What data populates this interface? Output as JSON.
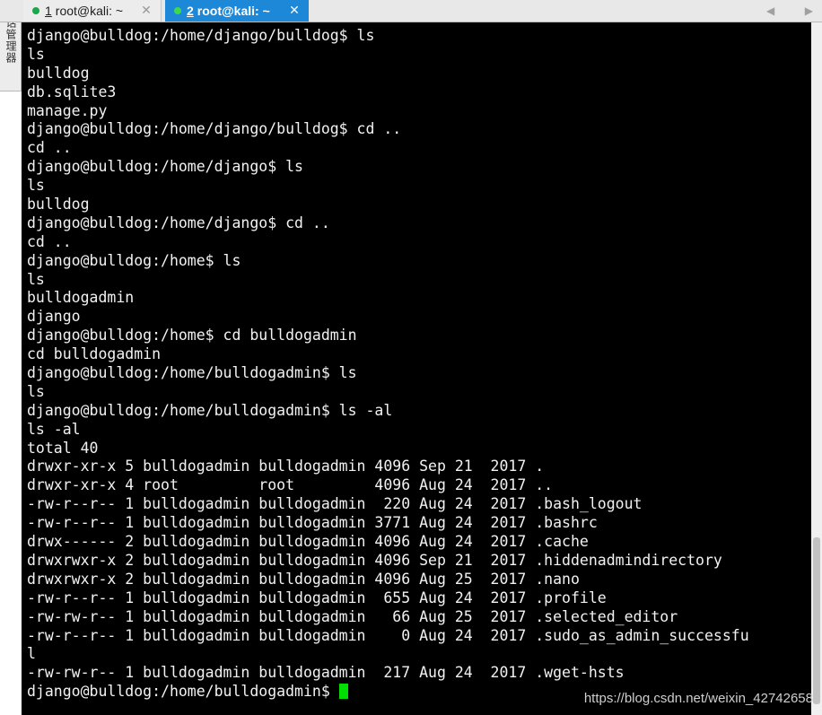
{
  "side_panel": {
    "label": "会话管理器"
  },
  "tabs": [
    {
      "number": "1",
      "title": "root@kali: ~",
      "active": false,
      "close_label": "✕"
    },
    {
      "number": "2",
      "title": "root@kali: ~",
      "active": true,
      "close_label": "✕"
    }
  ],
  "tab_nav": {
    "prev": "◀",
    "next": "▶"
  },
  "colors": {
    "terminal_bg": "#000000",
    "terminal_fg": "#f2f2f2",
    "active_tab": "#1e88d8",
    "cursor": "#00e000"
  },
  "terminal": {
    "lines": [
      "django@bulldog:/home/django/bulldog$ ls",
      "ls",
      "bulldog",
      "db.sqlite3",
      "manage.py",
      "django@bulldog:/home/django/bulldog$ cd ..",
      "cd ..",
      "django@bulldog:/home/django$ ls",
      "ls",
      "bulldog",
      "django@bulldog:/home/django$ cd ..",
      "cd ..",
      "django@bulldog:/home$ ls",
      "ls",
      "bulldogadmin",
      "django",
      "django@bulldog:/home$ cd bulldogadmin",
      "cd bulldogadmin",
      "django@bulldog:/home/bulldogadmin$ ls",
      "ls",
      "django@bulldog:/home/bulldogadmin$ ls -al",
      "ls -al",
      "total 40",
      "drwxr-xr-x 5 bulldogadmin bulldogadmin 4096 Sep 21  2017 .",
      "drwxr-xr-x 4 root         root         4096 Aug 24  2017 ..",
      "-rw-r--r-- 1 bulldogadmin bulldogadmin  220 Aug 24  2017 .bash_logout",
      "-rw-r--r-- 1 bulldogadmin bulldogadmin 3771 Aug 24  2017 .bashrc",
      "drwx------ 2 bulldogadmin bulldogadmin 4096 Aug 24  2017 .cache",
      "drwxrwxr-x 2 bulldogadmin bulldogadmin 4096 Sep 21  2017 .hiddenadmindirectory",
      "drwxrwxr-x 2 bulldogadmin bulldogadmin 4096 Aug 25  2017 .nano",
      "-rw-r--r-- 1 bulldogadmin bulldogadmin  655 Aug 24  2017 .profile",
      "-rw-rw-r-- 1 bulldogadmin bulldogadmin   66 Aug 25  2017 .selected_editor",
      "-rw-r--r-- 1 bulldogadmin bulldogadmin    0 Aug 24  2017 .sudo_as_admin_successfu",
      "l",
      "-rw-rw-r-- 1 bulldogadmin bulldogadmin  217 Aug 24  2017 .wget-hsts"
    ],
    "prompt": "django@bulldog:/home/bulldogadmin$ "
  },
  "watermark": "https://blog.csdn.net/weixin_42742658"
}
